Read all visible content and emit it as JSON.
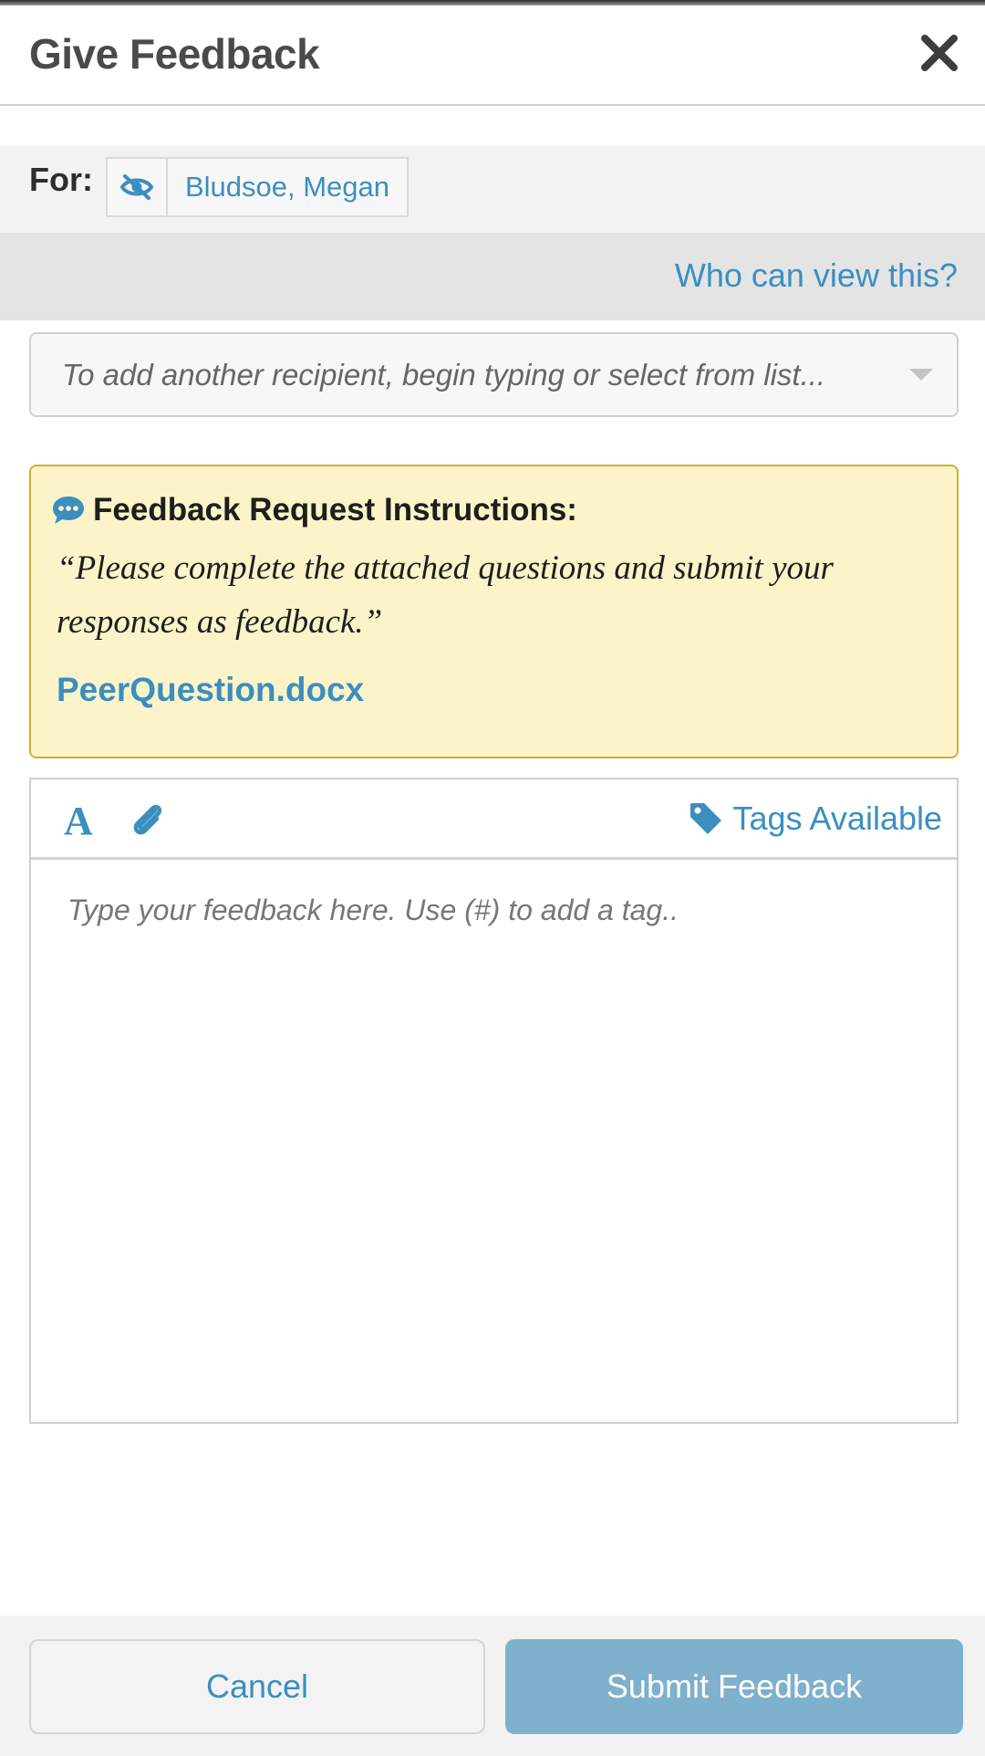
{
  "header": {
    "title": "Give Feedback",
    "close_icon": "close-icon"
  },
  "recipient": {
    "label": "For:",
    "name": "Bludsoe, Megan",
    "visibility_icon": "eye-slash-icon",
    "who_can_view_label": "Who can view this?",
    "add_placeholder": "To add another recipient, begin typing or select from list..."
  },
  "instructions": {
    "icon": "comment-dots-icon",
    "title": "Feedback Request Instructions:",
    "quote": "“Please complete the attached questions and submit your responses as feedback.”",
    "attachment": "PeerQuestion.docx"
  },
  "editor": {
    "font_icon_label": "A",
    "attach_icon": "paperclip-icon",
    "tag_icon": "tag-icon",
    "tags_label": "Tags Available",
    "placeholder": "Type your feedback here. Use (#) to add a tag.."
  },
  "footer": {
    "cancel_label": "Cancel",
    "submit_label": "Submit Feedback"
  },
  "colors": {
    "accent": "#3a8fbf",
    "submit_bg": "#7fb0cc",
    "instructions_bg": "#fdf3c9",
    "instructions_border": "#c8b230"
  }
}
